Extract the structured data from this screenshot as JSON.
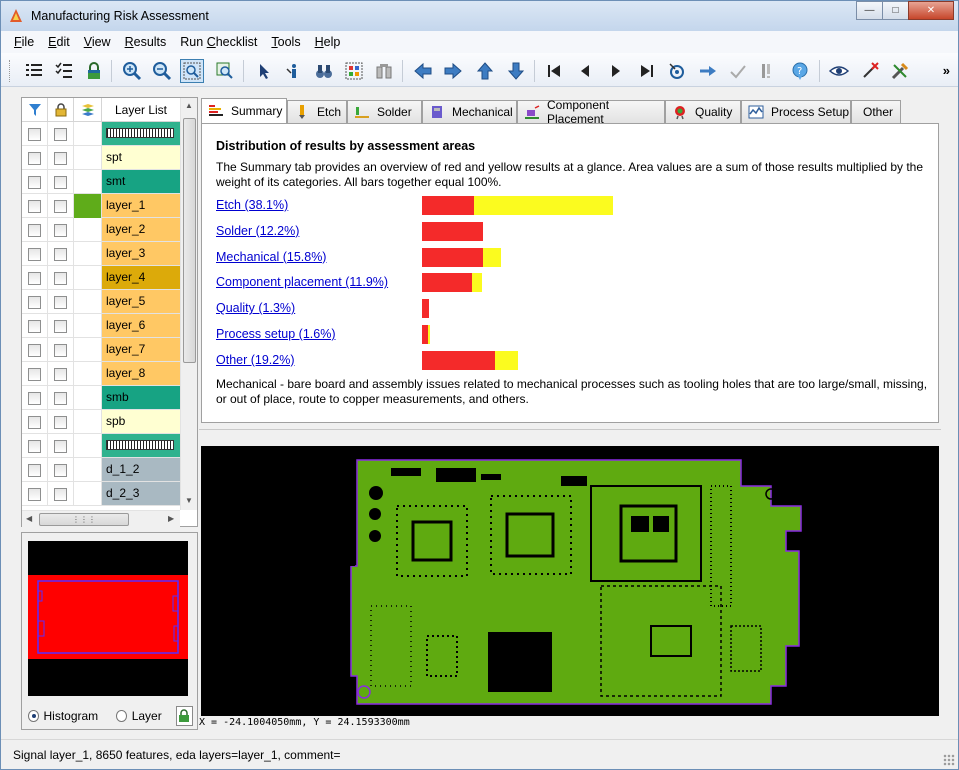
{
  "window": {
    "title": "Manufacturing Risk Assessment",
    "controls": [
      "minimize",
      "maximize",
      "close"
    ]
  },
  "menu": [
    "File",
    "Edit",
    "View",
    "Results",
    "Run Checklist",
    "Tools",
    "Help"
  ],
  "toolbar": {
    "icons": [
      "list-view-icon",
      "checklist-icon",
      "lock-icon",
      "zoom-in-icon",
      "zoom-out-icon",
      "zoom-area-icon",
      "zoom-fit-icon",
      "select-pointer-icon",
      "info-pointer-icon",
      "binoculars-icon",
      "grid-select-icon",
      "measure-icon",
      "arrow-left-icon",
      "arrow-right-icon",
      "arrow-up-icon",
      "arrow-down-icon",
      "first-icon",
      "previous-icon",
      "next-icon",
      "last-icon",
      "target-icon",
      "step-icon",
      "check-icon",
      "flag-icon",
      "help-bubble-icon",
      "eye-icon",
      "wand-icon",
      "tools-icon"
    ],
    "more": "»"
  },
  "layer_list": {
    "header": "Layer List",
    "rows": [
      {
        "name": "",
        "pattern": true,
        "color": "#2fb28e"
      },
      {
        "name": "spt",
        "color": "#ffffd2"
      },
      {
        "name": "smt",
        "color": "#17a383"
      },
      {
        "name": "layer_1",
        "color": "#ffc864",
        "active": true
      },
      {
        "name": "layer_2",
        "color": "#ffc864"
      },
      {
        "name": "layer_3",
        "color": "#ffc864"
      },
      {
        "name": "layer_4",
        "color": "#dcaa0a"
      },
      {
        "name": "layer_5",
        "color": "#ffc864"
      },
      {
        "name": "layer_6",
        "color": "#ffc864"
      },
      {
        "name": "layer_7",
        "color": "#ffc864"
      },
      {
        "name": "layer_8",
        "color": "#ffc864"
      },
      {
        "name": "smb",
        "color": "#17a383"
      },
      {
        "name": "spb",
        "color": "#ffffd2"
      },
      {
        "name": "",
        "pattern": true,
        "color": "#2fb28e"
      },
      {
        "name": "d_1_2",
        "color": "#a9b9c2"
      },
      {
        "name": "d_2_3",
        "color": "#a9b9c2"
      }
    ],
    "active_marker_color": "#5fac1a"
  },
  "preview": {
    "options": [
      "Histogram",
      "Layer"
    ],
    "selected": "Histogram"
  },
  "tabs": [
    "Summary",
    "Etch",
    "Solder",
    "Mechanical",
    "Component Placement",
    "Quality",
    "Process Setup",
    "Other"
  ],
  "active_tab": "Summary",
  "summary": {
    "title": "Distribution of results by assessment areas",
    "description": "The Summary tab provides an overview of red and yellow results at a glance.   Area values are a sum of those results multiplied by the weight of its categories.   All bars together equal 100%.",
    "areas": [
      {
        "label": "Etch (38.1%)",
        "red": 10.3,
        "yellow": 27.8
      },
      {
        "label": "Solder (12.2%)",
        "red": 12.2,
        "yellow": 0
      },
      {
        "label": "Mechanical (15.8%)",
        "red": 12.2,
        "yellow": 3.6
      },
      {
        "label": "Component placement (11.9%)",
        "red": 9.9,
        "yellow": 2.0
      },
      {
        "label": "Quality (1.3%)",
        "red": 1.3,
        "yellow": 0
      },
      {
        "label": "Process setup (1.6%)",
        "red": 1.2,
        "yellow": 0.4
      },
      {
        "label": "Other (19.2%)",
        "red": 14.6,
        "yellow": 4.6
      }
    ],
    "footer": "Mechanical - bare board and assembly issues related to mechanical processes such as tooling holes that are too large/small, missing, or out of place, route to copper measurements, and others."
  },
  "coordinates": "X = -24.1004050mm, Y = 24.1593300mm",
  "status": "Signal layer_1, 8650 features, eda layers=layer_1, comment=",
  "colors": {
    "red": "#f42a2a",
    "yellow": "#fbfb1f",
    "board": "#5faa10",
    "outline": "#8a2be2"
  }
}
